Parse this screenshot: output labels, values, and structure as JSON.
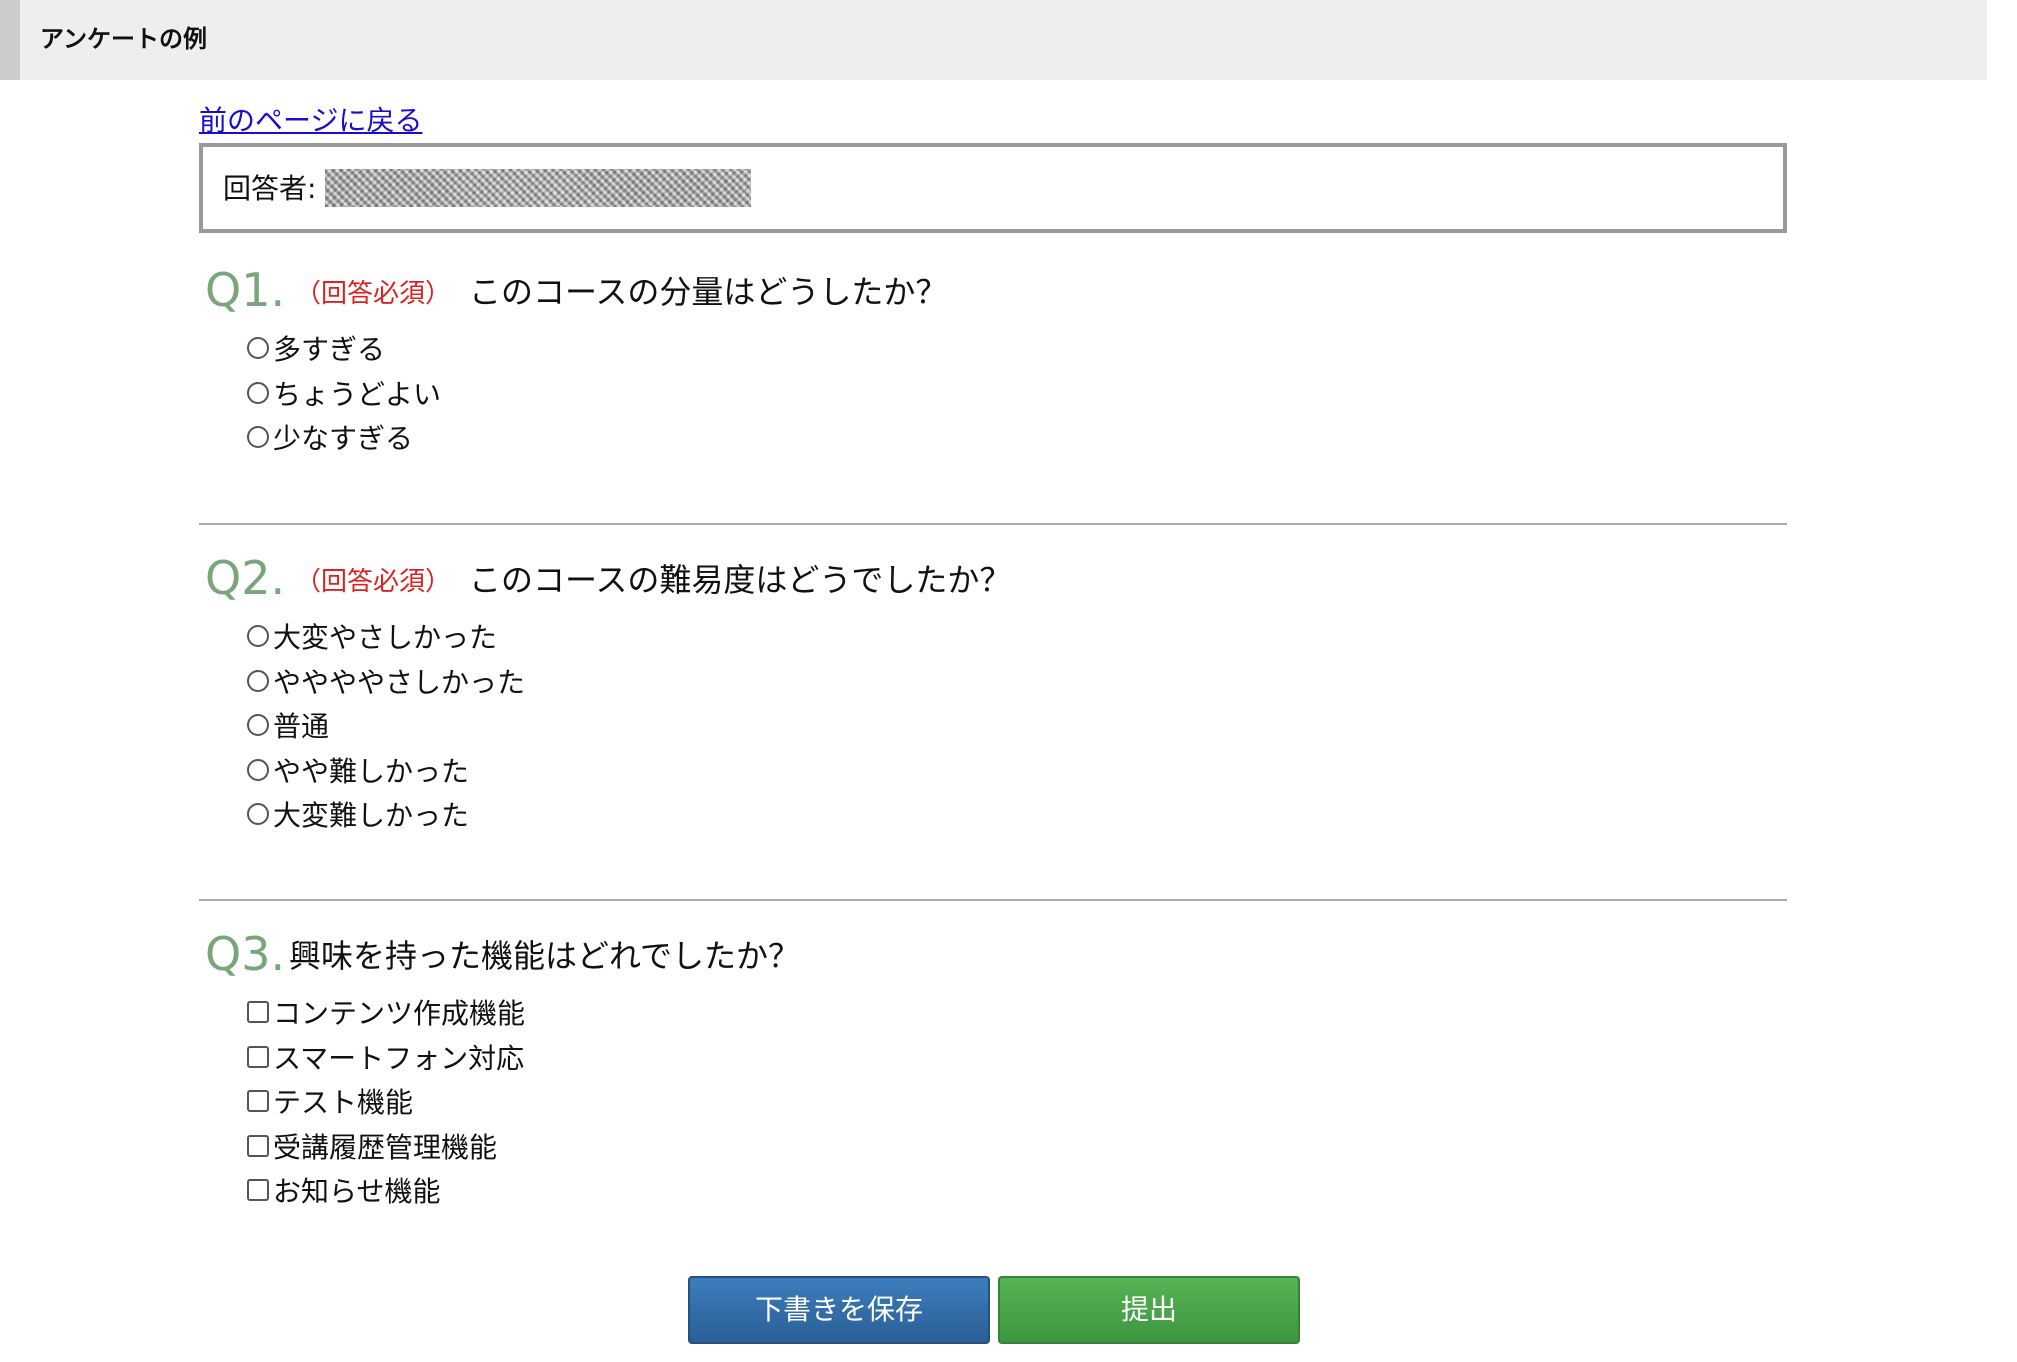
{
  "header": {
    "title": "アンケートの例"
  },
  "back_link": "前のページに戻る",
  "respondent": {
    "label": "回答者:"
  },
  "questions": [
    {
      "number": "Q1.",
      "required": "（回答必須）",
      "text": "このコースの分量はどうしたか？",
      "input": "radio",
      "options": [
        "多すぎる",
        "ちょうどよい",
        "少なすぎる"
      ]
    },
    {
      "number": "Q2.",
      "required": "（回答必須）",
      "text": "このコースの難易度はどうでしたか？",
      "input": "radio",
      "options": [
        "大変やさしかった",
        "ややややさしかった",
        "普通",
        "やや難しかった",
        "大変難しかった"
      ]
    },
    {
      "number": "Q3.",
      "text": "興味を持った機能はどれでしたか？",
      "input": "checkbox",
      "options": [
        "コンテンツ作成機能",
        "スマートフォン対応",
        "テスト機能",
        "受講履歴管理機能",
        "お知らせ機能"
      ]
    }
  ],
  "buttons": {
    "save": "下書きを保存",
    "submit": "提出"
  }
}
